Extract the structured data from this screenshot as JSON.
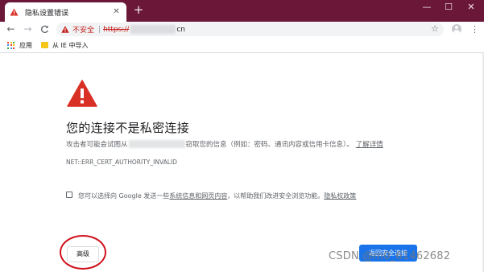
{
  "browser": {
    "tab": {
      "title": "隐私设置错误",
      "close_glyph": "✕"
    },
    "new_tab_glyph": "+",
    "window_controls": {
      "minimize": "—",
      "maximize": "☐",
      "close": "✕"
    },
    "toolbar": {
      "back_glyph": "←",
      "forward_glyph": "→",
      "reload_glyph": "C",
      "security_label": "不安全",
      "url_separator": "|",
      "url_scheme": "https://",
      "url_tail": "cn",
      "star_glyph": "☆",
      "menu_glyph": "⋮"
    },
    "bookmarks": [
      {
        "label": "应用",
        "icon": "apps-grid-icon"
      },
      {
        "label": "从 IE 中导入",
        "icon": "folder-icon"
      }
    ]
  },
  "interstitial": {
    "heading": "您的连接不是私密连接",
    "description_prefix": "攻击者可能会试图从",
    "description_suffix": "窃取您的信息（例如：密码、通讯内容或信用卡信息）。",
    "learn_more": "了解详情",
    "error_code": "NET::ERR_CERT_AUTHORITY_INVALID",
    "optin_prefix": "您可以选择向 Google 发送一些",
    "optin_link_system": "系统信息和网页内容",
    "optin_middle": "，以帮助我们改进安全浏览功能。",
    "optin_link_privacy": "隐私权政策",
    "advanced_button": "高级",
    "back_button": "返回安全连接"
  },
  "overlay": {
    "watermark": "CSDN @m0_61462682"
  },
  "colors": {
    "frame": "#6b1738",
    "warning_red": "#d93025",
    "not_secure_red": "#c5221f",
    "primary_blue": "#1a73e8",
    "highlight_circle": "#d0101b"
  }
}
